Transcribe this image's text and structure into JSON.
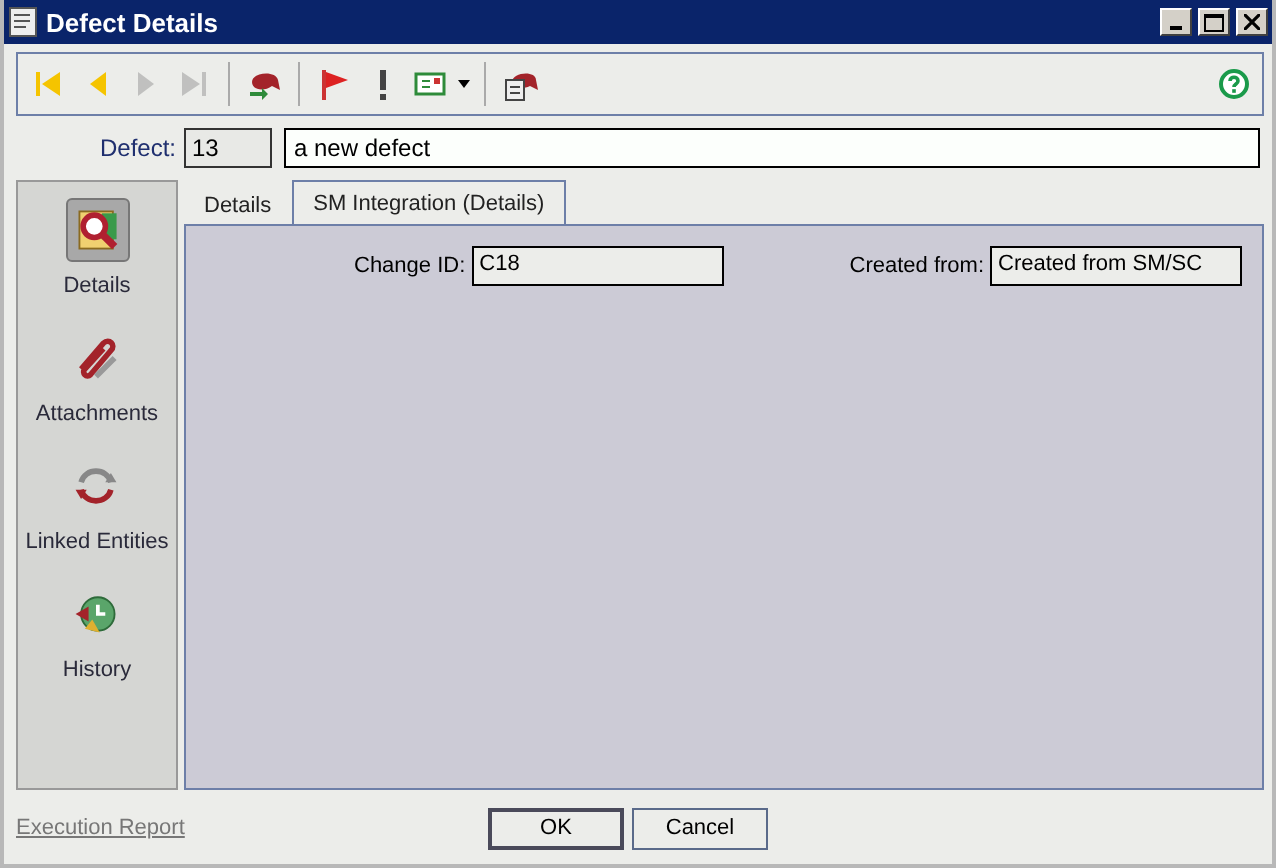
{
  "window": {
    "title": "Defect Details"
  },
  "toolbar": [
    {
      "kind": "first",
      "disabled": false
    },
    {
      "kind": "previous",
      "disabled": false
    },
    {
      "kind": "next",
      "disabled": true
    },
    {
      "kind": "last",
      "disabled": true
    },
    {
      "kind": "sep"
    },
    {
      "kind": "bubble-arrow",
      "disabled": false
    },
    {
      "kind": "sep"
    },
    {
      "kind": "flag",
      "disabled": false
    },
    {
      "kind": "exclaim",
      "disabled": false
    },
    {
      "kind": "mail",
      "disabled": false
    },
    {
      "kind": "sep"
    },
    {
      "kind": "bubble-doc",
      "disabled": false
    }
  ],
  "defect": {
    "label": "Defect:",
    "id": "13",
    "summary": "a new defect"
  },
  "sidebar": {
    "items": [
      {
        "kind": "details",
        "label": "Details",
        "selected": true
      },
      {
        "kind": "attachments",
        "label": "Attachments",
        "selected": false
      },
      {
        "kind": "linked",
        "label": "Linked Entities",
        "selected": false
      },
      {
        "kind": "history",
        "label": "History",
        "selected": false
      }
    ]
  },
  "tabs": [
    {
      "label": "Details",
      "selected": false
    },
    {
      "label": "SM Integration (Details)",
      "selected": true
    }
  ],
  "fields": [
    {
      "label": "Change ID:",
      "value": "C18"
    },
    {
      "label": "Created from:",
      "value": "Created from SM/SC"
    }
  ],
  "footer": {
    "link": "Execution Report",
    "buttons": [
      {
        "label": "OK",
        "default": true
      },
      {
        "label": "Cancel",
        "default": false
      }
    ]
  }
}
